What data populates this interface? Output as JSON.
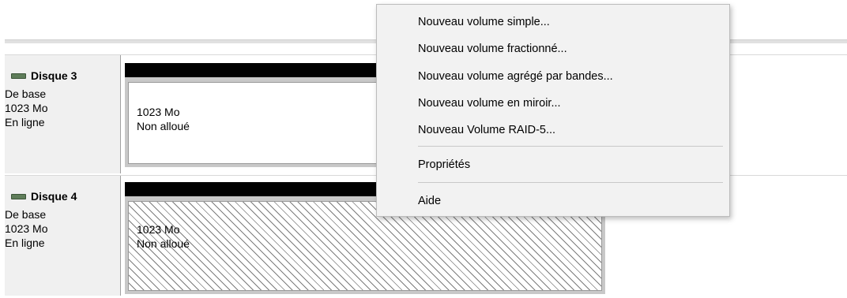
{
  "disks": [
    {
      "name": "Disque 3",
      "type": "De base",
      "size": "1023 Mo",
      "status": "En ligne",
      "partition": {
        "size": "1023 Mo",
        "state": "Non alloué"
      }
    },
    {
      "name": "Disque 4",
      "type": "De base",
      "size": "1023 Mo",
      "status": "En ligne",
      "partition": {
        "size": "1023 Mo",
        "state": "Non alloué"
      }
    }
  ],
  "context_menu": {
    "items": [
      "Nouveau volume simple...",
      "Nouveau volume fractionné...",
      "Nouveau volume agrégé par bandes...",
      "Nouveau volume en miroir...",
      "Nouveau Volume RAID-5...",
      "Propriétés",
      "Aide"
    ]
  }
}
